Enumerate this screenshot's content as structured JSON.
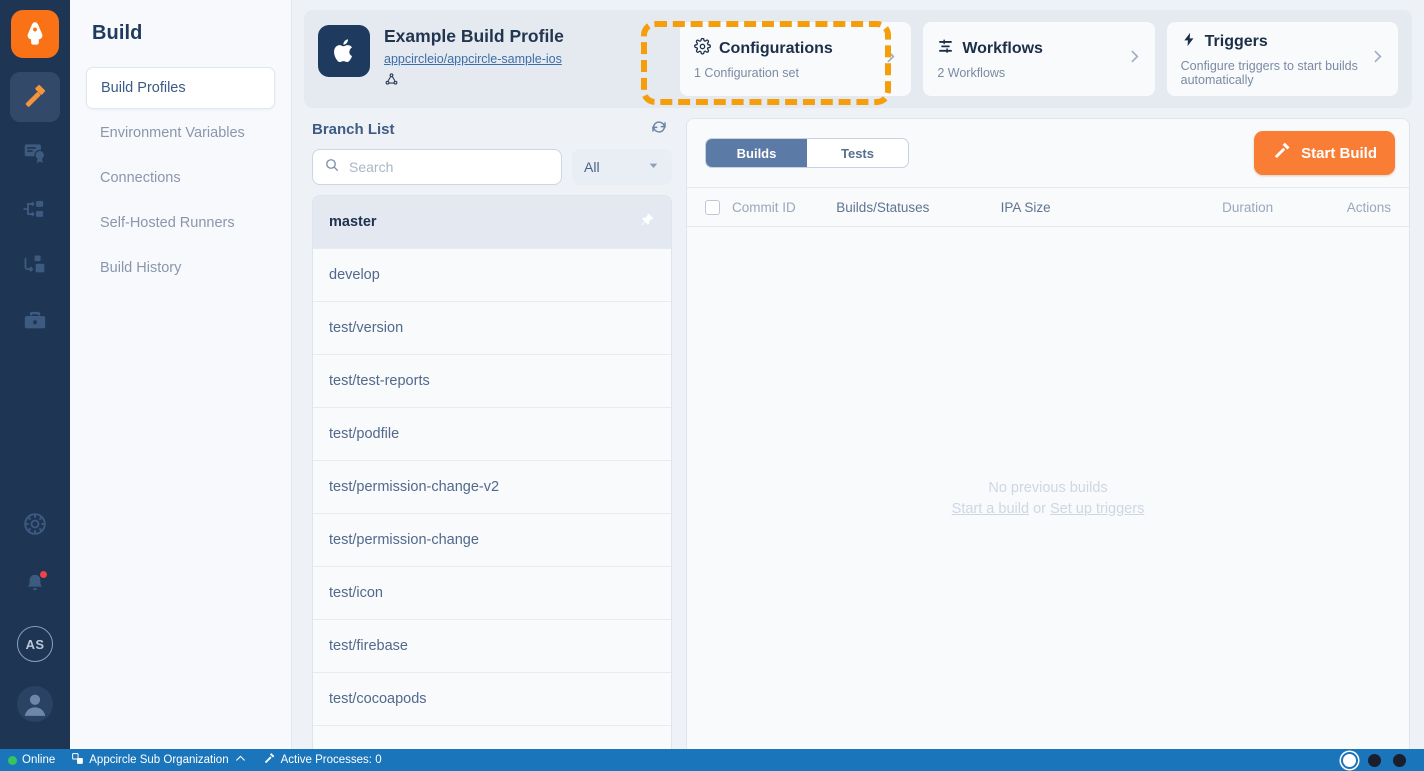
{
  "rail": {
    "logo_icon": "appcircle-logo-icon",
    "items": [
      {
        "icon": "hammer-build-icon",
        "name": "build",
        "active": true
      },
      {
        "icon": "certificate-signing-icon",
        "name": "signing-identities",
        "active": false
      },
      {
        "icon": "distribution-icon",
        "name": "distribution",
        "active": false
      },
      {
        "icon": "store-submit-icon",
        "name": "store-submission",
        "active": false
      },
      {
        "icon": "toolbox-icon",
        "name": "resources",
        "active": false
      }
    ],
    "bottom": [
      {
        "icon": "settings-wheel-icon",
        "name": "settings"
      },
      {
        "icon": "bell-notification-icon",
        "name": "notifications",
        "badge": true
      },
      {
        "icon": "organization-avatar",
        "name": "organization-avatar",
        "initials": "AS"
      },
      {
        "icon": "user-avatar-icon",
        "name": "user-avatar"
      }
    ]
  },
  "subnav": {
    "title": "Build",
    "items": [
      {
        "label": "Build Profiles",
        "active": true
      },
      {
        "label": "Environment Variables",
        "active": false
      },
      {
        "label": "Connections",
        "active": false
      },
      {
        "label": "Self-Hosted Runners",
        "active": false
      },
      {
        "label": "Build History",
        "active": false
      }
    ]
  },
  "profile": {
    "platform_icon": "apple-icon",
    "name": "Example Build Profile",
    "repo": "appcircleio/appcircle-sample-ios",
    "vcs_icon": "git-connection-icon"
  },
  "cards": [
    {
      "icon": "gear-icon",
      "title": "Configurations",
      "subtitle": "1 Configuration set",
      "highlighted": true
    },
    {
      "icon": "workflow-icon",
      "title": "Workflows",
      "subtitle": "2 Workflows",
      "highlighted": false
    },
    {
      "icon": "lightning-bolt-icon",
      "title": "Triggers",
      "subtitle": "Configure triggers to start builds automatically",
      "highlighted": false
    }
  ],
  "branches": {
    "heading": "Branch List",
    "refresh_icon": "refresh-icon",
    "search": {
      "value": "",
      "placeholder": "Search",
      "icon": "search-icon"
    },
    "filter": {
      "value": "All",
      "icon": "chevron-down-icon"
    },
    "items": [
      {
        "name": "master",
        "selected": true,
        "pinned": true
      },
      {
        "name": "develop",
        "selected": false,
        "pinned": false
      },
      {
        "name": "test/version",
        "selected": false,
        "pinned": false
      },
      {
        "name": "test/test-reports",
        "selected": false,
        "pinned": false
      },
      {
        "name": "test/podfile",
        "selected": false,
        "pinned": false
      },
      {
        "name": "test/permission-change-v2",
        "selected": false,
        "pinned": false
      },
      {
        "name": "test/permission-change",
        "selected": false,
        "pinned": false
      },
      {
        "name": "test/icon",
        "selected": false,
        "pinned": false
      },
      {
        "name": "test/firebase",
        "selected": false,
        "pinned": false
      },
      {
        "name": "test/cocoapods",
        "selected": false,
        "pinned": false
      }
    ]
  },
  "builds": {
    "tabs": [
      {
        "label": "Builds",
        "active": true
      },
      {
        "label": "Tests",
        "active": false
      }
    ],
    "start_build": {
      "label": "Start Build",
      "icon": "hammer-icon"
    },
    "columns": [
      {
        "label": "Commit ID",
        "dim": true
      },
      {
        "label": "Builds/Statuses",
        "dim": false
      },
      {
        "label": "IPA Size",
        "dim": false
      },
      {
        "label": "Duration",
        "dim": true
      },
      {
        "label": "Actions",
        "dim": true
      }
    ],
    "empty": {
      "line1": "No previous builds",
      "link1": "Start a build",
      "or": "or",
      "link2": "Set up triggers"
    }
  },
  "statusbar": {
    "online": "Online",
    "organization": "Appcircle Sub Organization",
    "org_icon": "organization-icon",
    "chevron_icon": "chevron-up-icon",
    "processes_icon": "hammer-icon",
    "processes": "Active Processes: 0"
  },
  "colors": {
    "brand_orange": "#f97316",
    "navy": "#1e3553",
    "status_blue": "#1b75bb",
    "highlight": "#f59e0b",
    "online_green": "#35c45e"
  }
}
